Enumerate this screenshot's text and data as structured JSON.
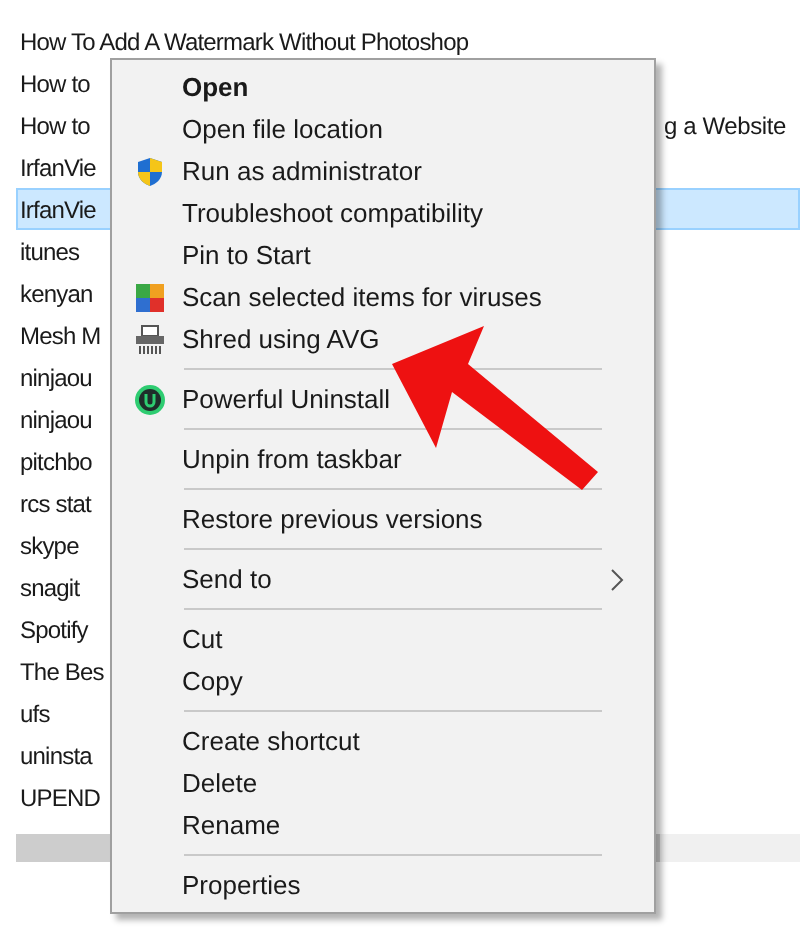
{
  "files": [
    {
      "name": "How To Add A Watermark Without Photoshop",
      "selected": false
    },
    {
      "name": "How to",
      "selected": false
    },
    {
      "name": "How to",
      "name_right": "g a Website",
      "selected": false
    },
    {
      "name": "IrfanVie",
      "selected": false
    },
    {
      "name": "IrfanVie",
      "selected": true
    },
    {
      "name": "itunes",
      "selected": false
    },
    {
      "name": "kenyan",
      "selected": false
    },
    {
      "name": "Mesh M",
      "selected": false
    },
    {
      "name": "ninjaou",
      "selected": false
    },
    {
      "name": "ninjaou",
      "selected": false
    },
    {
      "name": "pitchbo",
      "selected": false
    },
    {
      "name": "rcs stat",
      "selected": false
    },
    {
      "name": "skype",
      "selected": false
    },
    {
      "name": "snagit",
      "selected": false
    },
    {
      "name": "Spotify",
      "selected": false
    },
    {
      "name": "The Bes",
      "selected": false
    },
    {
      "name": "ufs",
      "selected": false
    },
    {
      "name": "uninsta",
      "selected": false
    },
    {
      "name": "UPEND",
      "selected": false
    }
  ],
  "context_menu": [
    {
      "kind": "default",
      "label": "Open"
    },
    {
      "kind": "plain",
      "label": "Open file location"
    },
    {
      "kind": "shield",
      "label": "Run as administrator"
    },
    {
      "kind": "plain",
      "label": "Troubleshoot compatibility"
    },
    {
      "kind": "plain",
      "label": "Pin to Start"
    },
    {
      "kind": "scan",
      "label": "Scan selected items for viruses"
    },
    {
      "kind": "shred",
      "label": "Shred using AVG"
    },
    {
      "kind": "separator"
    },
    {
      "kind": "uninstall",
      "label": "Powerful Uninstall"
    },
    {
      "kind": "separator"
    },
    {
      "kind": "plain",
      "label": "Unpin from taskbar"
    },
    {
      "kind": "separator"
    },
    {
      "kind": "plain",
      "label": "Restore previous versions"
    },
    {
      "kind": "separator"
    },
    {
      "kind": "submenu",
      "label": "Send to"
    },
    {
      "kind": "separator"
    },
    {
      "kind": "plain",
      "label": "Cut"
    },
    {
      "kind": "plain",
      "label": "Copy"
    },
    {
      "kind": "separator"
    },
    {
      "kind": "plain",
      "label": "Create shortcut"
    },
    {
      "kind": "plain",
      "label": "Delete"
    },
    {
      "kind": "plain",
      "label": "Rename"
    },
    {
      "kind": "separator"
    },
    {
      "kind": "plain",
      "label": "Properties"
    }
  ]
}
